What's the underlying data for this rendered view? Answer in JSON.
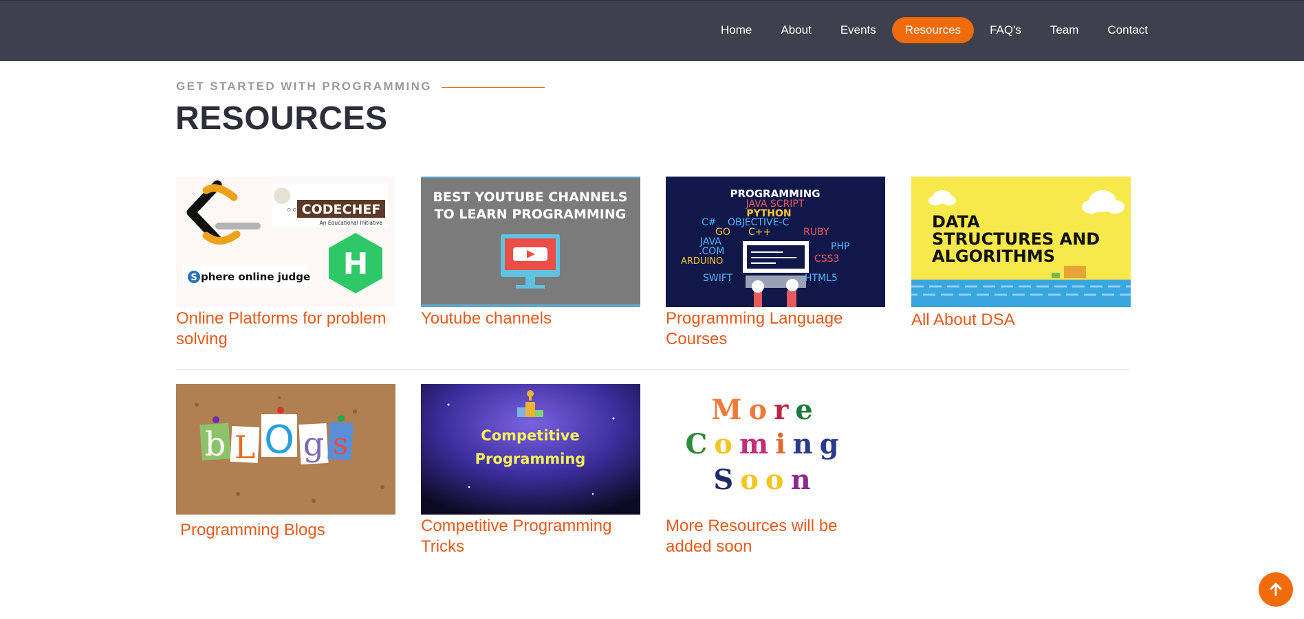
{
  "nav": {
    "items": [
      "Home",
      "About",
      "Events",
      "Resources",
      "FAQ's",
      "Team",
      "Contact"
    ],
    "active": "Resources",
    "accent": "#f26b0a"
  },
  "section": {
    "eyebrow": "GET STARTED WITH PROGRAMMING",
    "title": "RESOURCES"
  },
  "cards": [
    {
      "title": "Online Platforms for problem solving",
      "thumb": {
        "codechef": "CODECHEF",
        "codechef_sub": "An Educational Initiative",
        "spoj": "phere online judge",
        "spoj_mark": "S",
        "hackerrank": "H"
      }
    },
    {
      "title": "Youtube channels",
      "thumb": {
        "line1": "BEST YOUTUBE CHANNELS",
        "line2": "TO LEARN PROGRAMMING"
      }
    },
    {
      "title": "Programming Language Courses",
      "thumb": {
        "heading": "PROGRAMMING",
        "langs": [
          "JAVA SCRIPT",
          "PYTHON",
          "C#",
          "OBJECTIVE-C",
          "GO",
          "C++",
          "RUBY",
          "JAVA",
          ".COM",
          "PHP",
          "ARDUINO",
          "CSS3",
          "SWIFT",
          "HTML5"
        ]
      }
    },
    {
      "title": "All About DSA",
      "thumb": {
        "lines": [
          "DATA",
          "STRUCTURES AND",
          "ALGORITHMS"
        ]
      }
    },
    {
      "title": "Programming Blogs",
      "thumb": {
        "letters": [
          "b",
          "L",
          "O",
          "g",
          "s"
        ]
      }
    },
    {
      "title": "Competitive Programming Tricks",
      "thumb": {
        "line1": "Competitive",
        "line2": "Programming"
      }
    },
    {
      "title": "More Resources will be added soon",
      "thumb": {
        "words": [
          "More",
          "Coming",
          "Soon"
        ]
      }
    }
  ]
}
